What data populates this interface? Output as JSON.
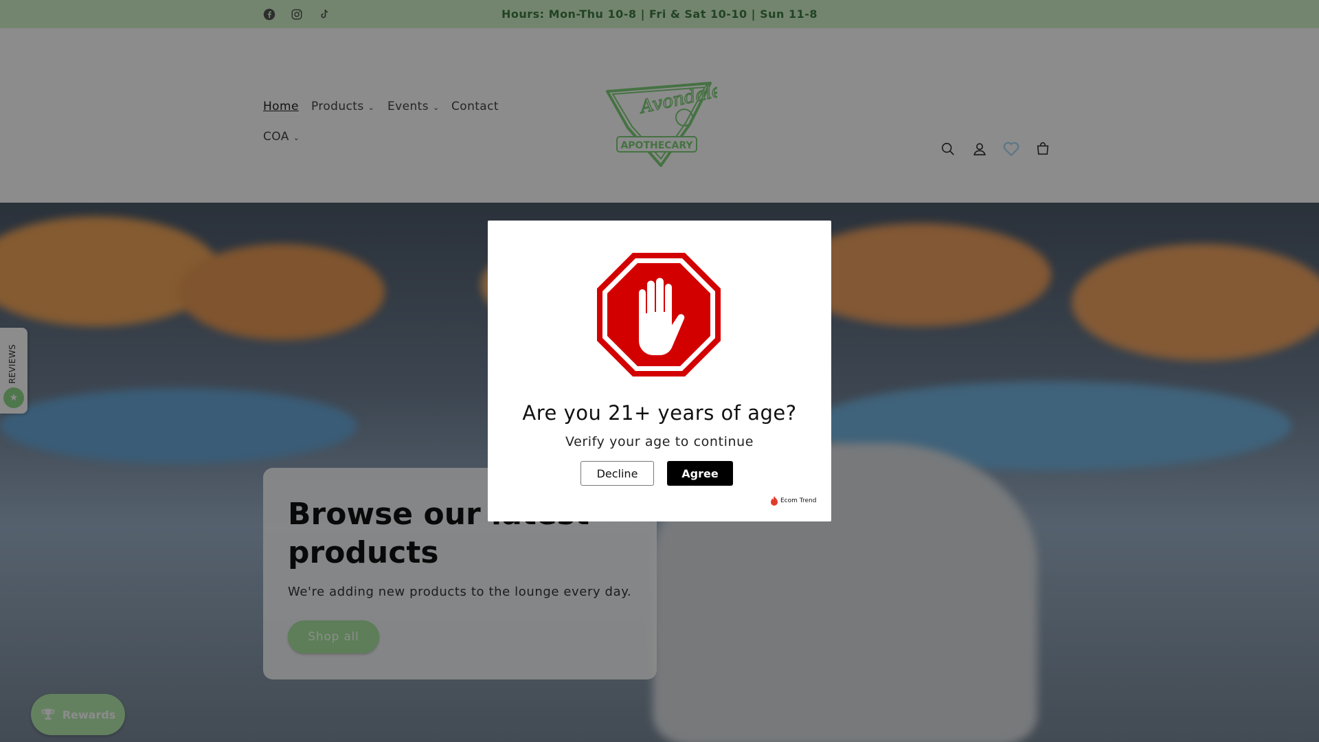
{
  "announcement": {
    "text": "Hours: Mon-Thu 10-8 | Fri & Sat 10-10 | Sun 11-8",
    "social_icons": [
      "facebook-icon",
      "instagram-icon",
      "tiktok-icon"
    ]
  },
  "nav": {
    "items": [
      {
        "label": "Home",
        "active": true
      },
      {
        "label": "Products",
        "has_dropdown": true
      },
      {
        "label": "Events",
        "has_dropdown": true
      },
      {
        "label": "Contact"
      },
      {
        "label": "COA",
        "has_dropdown": true
      }
    ]
  },
  "logo": {
    "line1": "Avondale",
    "line2": "APOTHECARY"
  },
  "header_icons": [
    "search-icon",
    "account-icon",
    "wishlist-heart-icon",
    "cart-icon"
  ],
  "hero": {
    "title": "Browse our latest products",
    "subtitle": "We're adding new products to the lounge every day.",
    "button_label": "Shop all"
  },
  "widgets": {
    "reviews_label": "REVIEWS",
    "rewards_label": "Rewards"
  },
  "age_modal": {
    "title": "Are you 21+ years of age?",
    "subtitle": "Verify your age to continue",
    "decline_label": "Decline",
    "agree_label": "Agree",
    "brand": "Ecom Trend"
  },
  "colors": {
    "announcement_bg": "#d2f3c8",
    "accent_green": "#a9e6a0",
    "stop_red": "#d30000"
  }
}
